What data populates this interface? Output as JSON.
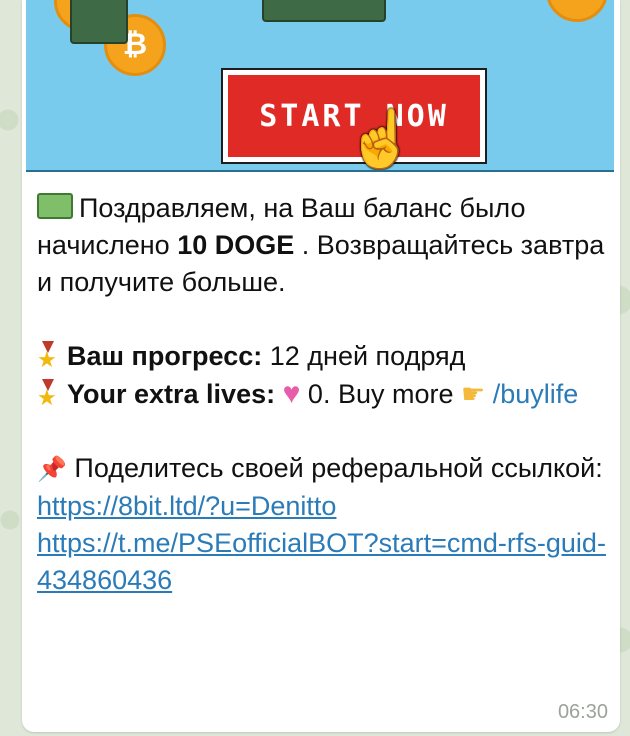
{
  "banner": {
    "button_label": "START NOW",
    "coin_symbol": "₿"
  },
  "message": {
    "line1_text": "Поздравляем, на Ваш баланс было начислено ",
    "amount": "10 DOGE",
    "line1_suffix": " . Возвращайтесь завтра и получите больше.",
    "progress_label": "Ваш прогресс:",
    "progress_value": " 12 дней подряд",
    "lives_label": "Your extra lives:",
    "lives_value": " 0. Buy more ",
    "buylife_link": "/buylife",
    "share_text": "Поделитесь своей реферальной ссылкой:",
    "ref_link_1": "https://8bit.ltd/?u=Denitto",
    "ref_link_2": "https://t.me/PSEofficialBOT?start=cmd-rfs-guid-434860436"
  },
  "timestamp": "06:30",
  "colors": {
    "link": "#2a7bb8",
    "button_red": "#e02a25",
    "banner_sky": "#79cbee"
  },
  "icons": [
    "money-icon",
    "medal-icon",
    "sparkling-heart-icon",
    "pointing-hand-icon",
    "pushpin-icon"
  ]
}
